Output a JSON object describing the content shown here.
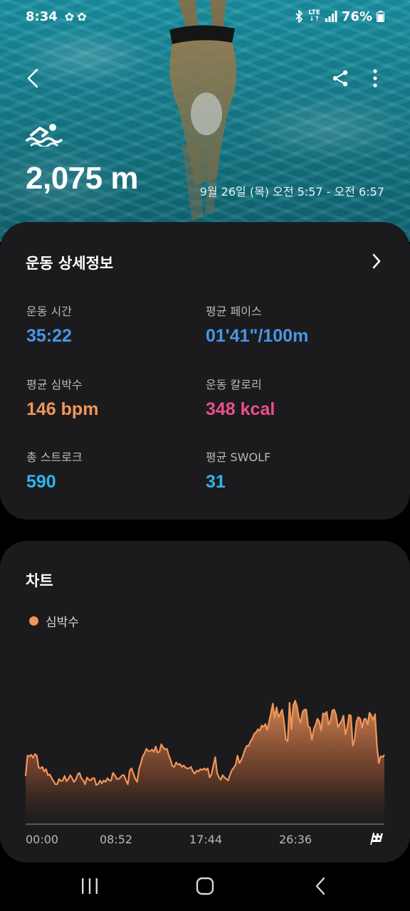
{
  "status_bar": {
    "time": "8:34",
    "network": "LTE",
    "battery": "76%"
  },
  "workout": {
    "activity_icon": "swimming-icon",
    "distance": "2,075 m",
    "session_time": "9월 26일 (목) 오전 5:57 - 오전 6:57"
  },
  "details": {
    "title": "운동 상세정보",
    "metrics": [
      {
        "label": "운동 시간",
        "value": "35:22",
        "color": "#4a95e6"
      },
      {
        "label": "평균 페이스",
        "value": "01'41\"/100m",
        "color": "#4a95e6"
      },
      {
        "label": "평균 심박수",
        "value": "146 bpm",
        "color": "#f0955a"
      },
      {
        "label": "운동 칼로리",
        "value": "348 kcal",
        "color": "#ec4f8b"
      },
      {
        "label": "총 스트로크",
        "value": "590",
        "color": "#2fb4f0"
      },
      {
        "label": "평균 SWOLF",
        "value": "31",
        "color": "#2fb4f0"
      }
    ]
  },
  "chart": {
    "title": "차트",
    "legend": "심박수",
    "x_ticks": [
      "00:00",
      "08:52",
      "17:44",
      "26:36"
    ]
  },
  "chart_data": {
    "type": "area",
    "title": "",
    "xlabel": "",
    "ylabel": "",
    "series": [
      {
        "name": "심박수",
        "color": "#f0955a",
        "values": [
          64,
          91,
          90,
          92,
          88,
          93,
          91,
          75,
          74,
          76,
          70,
          73,
          65,
          66,
          61,
          57,
          53,
          53,
          60,
          57,
          58,
          64,
          57,
          60,
          65,
          61,
          56,
          59,
          66,
          68,
          61,
          58,
          53,
          62,
          59,
          58,
          61,
          61,
          52,
          53,
          58,
          54,
          58,
          56,
          61,
          58,
          58,
          68,
          65,
          60,
          60,
          62,
          65,
          65,
          58,
          53,
          71,
          74,
          67,
          60,
          56,
          73,
          81,
          90,
          94,
          100,
          97,
          97,
          99,
          96,
          103,
          95,
          96,
          106,
          102,
          99,
          100,
          91,
          85,
          77,
          76,
          82,
          79,
          80,
          76,
          78,
          75,
          74,
          74,
          76,
          70,
          67,
          71,
          70,
          73,
          72,
          74,
          72,
          74,
          62,
          66,
          78,
          89,
          68,
          62,
          59,
          65,
          62,
          60,
          58,
          66,
          72,
          75,
          79,
          91,
          81,
          85,
          91,
          99,
          104,
          104,
          110,
          114,
          120,
          122,
          126,
          124,
          131,
          129,
          133,
          125,
          136,
          148,
          160,
          141,
          155,
          142,
          147,
          152,
          136,
          112,
          110,
          161,
          126,
          158,
          164,
          156,
          141,
          135,
          149,
          152,
          152,
          130,
          128,
          112,
          126,
          132,
          140,
          136,
          124,
          147,
          146,
          149,
          132,
          137,
          151,
          152,
          145,
          129,
          133,
          137,
          144,
          119,
          128,
          145,
          144,
          104,
          112,
          136,
          142,
          140,
          128,
          139,
          140,
          132,
          148,
          144,
          138,
          146,
          103,
          81,
          90,
          89,
          92
        ]
      }
    ],
    "x_range": [
      "00:00",
      "35:22"
    ],
    "x_ticks": [
      "00:00",
      "08:52",
      "17:44",
      "26:36"
    ],
    "y_range": [
      0,
      170
    ],
    "grid": false,
    "legend_position": "top-left"
  },
  "nav": {
    "recent_icon": "recent-apps-icon",
    "home_icon": "home-icon",
    "back_icon": "back-icon"
  }
}
